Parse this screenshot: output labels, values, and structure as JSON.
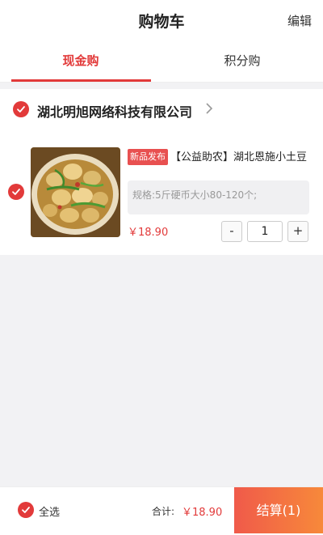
{
  "header": {
    "title": "购物车",
    "edit_label": "编辑"
  },
  "tabs": [
    {
      "label": "现金购",
      "active": true
    },
    {
      "label": "积分购",
      "active": false
    }
  ],
  "shop": {
    "name": "湖北明旭网络科技有限公司",
    "checked": true
  },
  "item": {
    "checked": true,
    "badge": "新品发布",
    "title": "【公益助农】湖北恩施小土豆",
    "spec": "规格:5斤硬币大小80-120个;",
    "price": "￥18.90",
    "quantity": "1",
    "minus": "-",
    "plus": "+"
  },
  "footer": {
    "select_all_label": "全选",
    "total_label": "合计:",
    "total_value": "￥18.90",
    "checkout_label": "结算(1)"
  },
  "colors": {
    "accent": "#e23a3a",
    "checkout_start": "#f05a4a",
    "checkout_end": "#f7893a"
  },
  "icons": {
    "check": "check-circle-icon",
    "chevron": "chevron-right-icon"
  }
}
